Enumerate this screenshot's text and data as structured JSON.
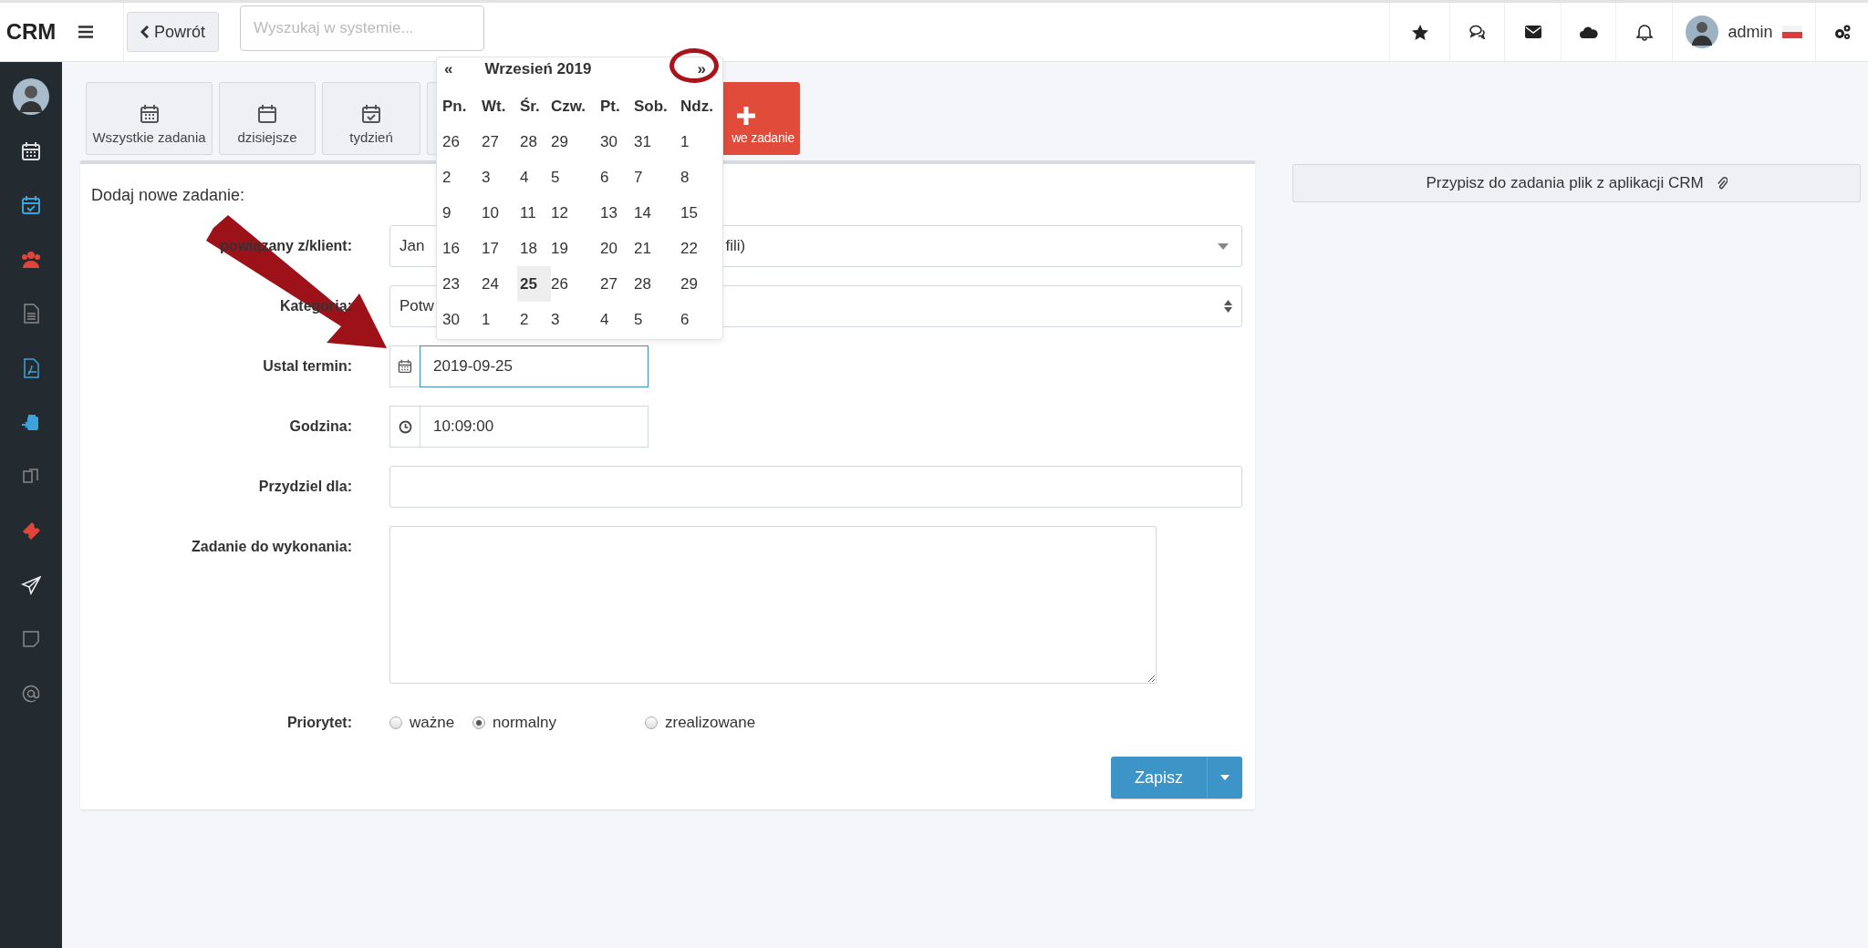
{
  "topbar": {
    "logo": "CRM",
    "back_button": "Powrót",
    "search": {
      "placeholder": "Wyszukaj w systemie..."
    },
    "user": "admin"
  },
  "toolbar": [
    {
      "kind": "all",
      "label": "Wszystkie zadania"
    },
    {
      "kind": "today",
      "label": "dzisiejsze"
    },
    {
      "kind": "week",
      "label": "tydzień"
    },
    {
      "kind": "covered"
    },
    {
      "kind": "new",
      "label": "we zadanie"
    }
  ],
  "form": {
    "title": "Dodaj nowe zadanie:",
    "fields": [
      {
        "kind": "select",
        "label": "powiązany z/klient:",
        "value": "Jan",
        "value_end": "fili)"
      },
      {
        "kind": "spinner",
        "label": "Kategoria:",
        "value": "Potw"
      },
      {
        "kind": "date",
        "label": "Ustal termin:",
        "value": "2019-09-25",
        "focused": true
      },
      {
        "kind": "time",
        "label": "Godzina:",
        "value": "10:09:00",
        "focused": false
      },
      {
        "kind": "text",
        "label": "Przydziel dla:"
      },
      {
        "kind": "textarea",
        "label": "Zadanie do wykonania:"
      },
      {
        "kind": "radio",
        "label": "Priorytet:",
        "options": [
          {
            "label": "ważne",
            "selected": false
          },
          {
            "label": "normalny",
            "selected": true
          },
          {
            "label": "zrealizowane",
            "selected": false
          }
        ]
      }
    ],
    "save_button": "Zapisz"
  },
  "attach_button": "Przypisz do zadania plik z aplikacji CRM",
  "calendar": {
    "prev": "«",
    "title": "Wrzesień 2019",
    "next": "»",
    "weekdays": [
      "Pn.",
      "Wt.",
      "Śr.",
      "Czw.",
      "Pt.",
      "Sob.",
      "Ndz."
    ],
    "weeks": [
      [
        {
          "day": "26",
          "selected": false
        },
        {
          "day": "27",
          "selected": false
        },
        {
          "day": "28",
          "selected": false
        },
        {
          "day": "29",
          "selected": false
        },
        {
          "day": "30",
          "selected": false
        },
        {
          "day": "31",
          "selected": false
        },
        {
          "day": "1",
          "selected": false
        }
      ],
      [
        {
          "day": "2",
          "selected": false
        },
        {
          "day": "3",
          "selected": false
        },
        {
          "day": "4",
          "selected": false
        },
        {
          "day": "5",
          "selected": false
        },
        {
          "day": "6",
          "selected": false
        },
        {
          "day": "7",
          "selected": false
        },
        {
          "day": "8",
          "selected": false
        }
      ],
      [
        {
          "day": "9",
          "selected": false
        },
        {
          "day": "10",
          "selected": false
        },
        {
          "day": "11",
          "selected": false
        },
        {
          "day": "12",
          "selected": false
        },
        {
          "day": "13",
          "selected": false
        },
        {
          "day": "14",
          "selected": false
        },
        {
          "day": "15",
          "selected": false
        }
      ],
      [
        {
          "day": "16",
          "selected": false
        },
        {
          "day": "17",
          "selected": false
        },
        {
          "day": "18",
          "selected": false
        },
        {
          "day": "19",
          "selected": false
        },
        {
          "day": "20",
          "selected": false
        },
        {
          "day": "21",
          "selected": false
        },
        {
          "day": "22",
          "selected": false
        }
      ],
      [
        {
          "day": "23",
          "selected": false
        },
        {
          "day": "24",
          "selected": false
        },
        {
          "day": "25",
          "selected": true
        },
        {
          "day": "26",
          "selected": false
        },
        {
          "day": "27",
          "selected": false
        },
        {
          "day": "28",
          "selected": false
        },
        {
          "day": "29",
          "selected": false
        }
      ],
      [
        {
          "day": "30",
          "selected": false
        },
        {
          "day": "1",
          "selected": false
        },
        {
          "day": "2",
          "selected": false
        },
        {
          "day": "3",
          "selected": false
        },
        {
          "day": "4",
          "selected": false
        },
        {
          "day": "5",
          "selected": false
        },
        {
          "day": "6",
          "selected": false
        }
      ]
    ]
  }
}
